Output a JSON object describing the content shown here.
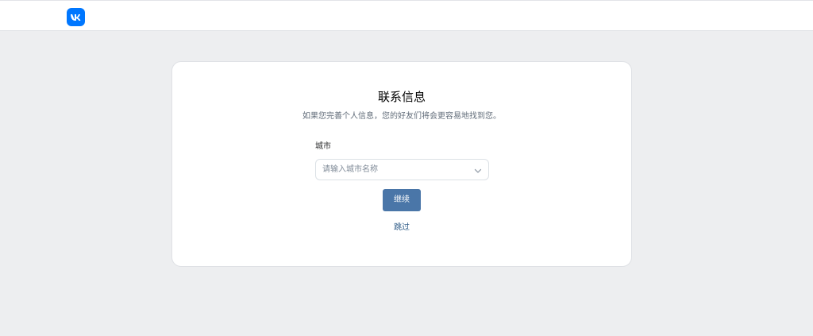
{
  "header": {
    "logo_text": "VK",
    "brand_color": "#0077ff"
  },
  "card": {
    "title": "联系信息",
    "subtitle": "如果您完善个人信息，您的好友们将会更容易地找到您。",
    "city_field": {
      "label": "城市",
      "placeholder": "请输入城市名称",
      "icon": "chevron-down-icon"
    },
    "continue_label": "继续",
    "continue_color": "#4a76a8",
    "skip_label": "跳过"
  }
}
